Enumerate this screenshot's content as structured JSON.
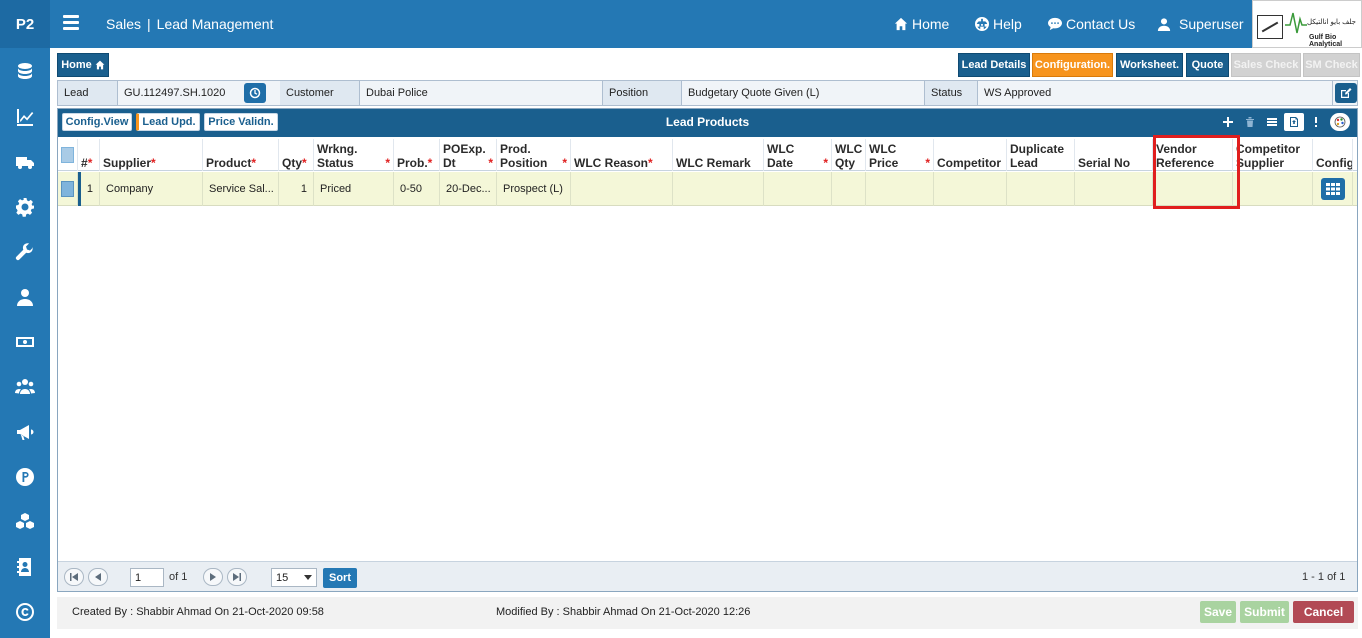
{
  "app": {
    "logo": "P2"
  },
  "header": {
    "module": "Sales",
    "page": "Lead Management",
    "nav": [
      {
        "icon": "home-icon",
        "label": "Home"
      },
      {
        "icon": "globe-icon",
        "label": "Help"
      },
      {
        "icon": "chat-icon",
        "label": "Contact Us"
      },
      {
        "icon": "user-icon",
        "label": "Superuser"
      }
    ],
    "brand": {
      "arabic": "جلف بايو انالتيكل",
      "english": "Gulf Bio Analytical"
    }
  },
  "sidebar": {
    "icons": [
      "database-icon",
      "chart-line-icon",
      "truck-icon",
      "gear-icon",
      "wrench-icon",
      "user-icon",
      "money-icon",
      "group-icon",
      "megaphone-icon",
      "p-circle-icon",
      "cubes-icon",
      "contact-book-icon",
      "copyright-icon"
    ]
  },
  "actions": {
    "home": "Home",
    "tabs": [
      {
        "label": "Lead Details",
        "style": "dark"
      },
      {
        "label": "Configuration.",
        "style": "orange"
      },
      {
        "label": "Worksheet.",
        "style": "dark"
      },
      {
        "label": "Quote",
        "style": "dark"
      },
      {
        "label": "Sales Check",
        "style": "disabled"
      },
      {
        "label": "SM Check",
        "style": "disabled"
      }
    ]
  },
  "info": {
    "lead_label": "Lead",
    "lead_value": "GU.112497.SH.1020",
    "customer_label": "Customer",
    "customer_value": "Dubai Police",
    "position_label": "Position",
    "position_value": "Budgetary Quote Given (L)",
    "status_label": "Status",
    "status_value": "WS Approved"
  },
  "panel": {
    "title": "Lead Products",
    "buttons": [
      "Config.View",
      "Lead Upd.",
      "Price Validn."
    ],
    "tools": [
      "plus-icon",
      "trash-icon",
      "list-icon",
      "export-icon",
      "more-icon",
      "palette-icon"
    ]
  },
  "grid": {
    "columns": [
      {
        "label": "#",
        "required": true
      },
      {
        "label": "Supplier",
        "required": true
      },
      {
        "label": "Product",
        "required": true
      },
      {
        "label": "Qty",
        "required": true
      },
      {
        "label": "Wrkng. Status",
        "required": true
      },
      {
        "label": "Prob.",
        "required": true
      },
      {
        "label": "POExp. Dt",
        "required": true
      },
      {
        "label": "Prod. Position",
        "required": true
      },
      {
        "label": "WLC Reason",
        "required": true
      },
      {
        "label": "WLC Remark",
        "required": false
      },
      {
        "label": "WLC Date",
        "required": true
      },
      {
        "label": "WLC Qty",
        "required": false
      },
      {
        "label": "WLC Price",
        "required": true
      },
      {
        "label": "Competitor",
        "required": false
      },
      {
        "label": "Duplicate Lead",
        "required": false
      },
      {
        "label": "Serial No",
        "required": false
      },
      {
        "label": "Vendor Reference",
        "required": false
      },
      {
        "label": "Competitor Supplier",
        "required": false
      },
      {
        "label": "Config",
        "required": false
      }
    ],
    "rows": [
      {
        "num": "1",
        "supplier": "Company",
        "product": "Service Sal...",
        "qty": "1",
        "status": "Priced",
        "prob": "0-50",
        "poexp": "20-Dec...",
        "position": "Prospect (L)"
      }
    ]
  },
  "pager": {
    "page": "1",
    "of_text": "of 1",
    "page_size": "15",
    "sort_label": "Sort",
    "range_text": "1 - 1 of 1"
  },
  "footer": {
    "created": "Created By : Shabbir Ahmad On 21-Oct-2020 09:58",
    "modified": "Modified By : Shabbir Ahmad On 21-Oct-2020 12:26",
    "save": "Save",
    "submit": "Submit",
    "cancel": "Cancel"
  }
}
